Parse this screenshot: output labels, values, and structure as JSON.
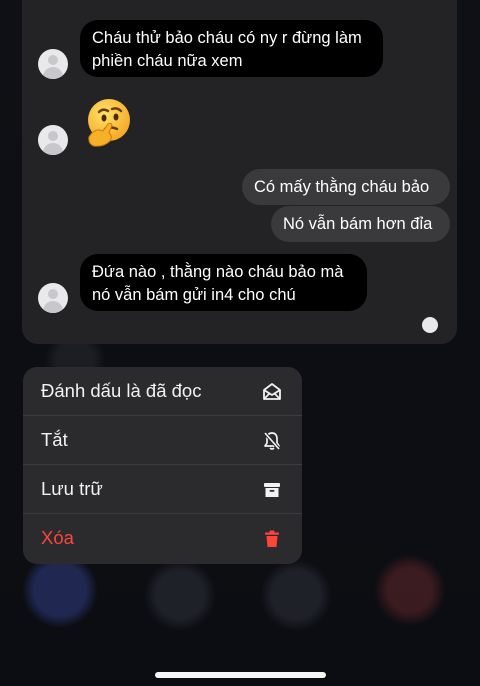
{
  "messages": [
    {
      "sender": "other",
      "text_line1": "Cháu thử bảo cháu có ny r đừng làm",
      "text_line2": "phiền cháu nữa xem"
    },
    {
      "sender": "other",
      "emoji": "thinking-face"
    },
    {
      "sender": "me",
      "text": "Có mấy thằng cháu bảo"
    },
    {
      "sender": "me",
      "text": "Nó vẫn bám hơn đỉa"
    },
    {
      "sender": "other",
      "text_line1": "Đứa nào , thằng nào cháu bảo mà",
      "text_line2": "nó vẫn bám gửi in4 cho chú"
    }
  ],
  "context_menu": {
    "items": [
      {
        "label": "Đánh dấu là đã đọc",
        "icon": "envelope-open-icon",
        "color": "#f2f2f2"
      },
      {
        "label": "Tắt",
        "icon": "bell-slash-icon",
        "color": "#f2f2f2"
      },
      {
        "label": "Lưu trữ",
        "icon": "archive-icon",
        "color": "#f2f2f2"
      },
      {
        "label": "Xóa",
        "icon": "trash-icon",
        "color": "#ff453a"
      }
    ]
  },
  "colors": {
    "incoming_bubble": "#000000",
    "outgoing_bubble": "#3a3a3c",
    "destructive": "#ff453a",
    "menu_background": "#2b2b2e"
  }
}
